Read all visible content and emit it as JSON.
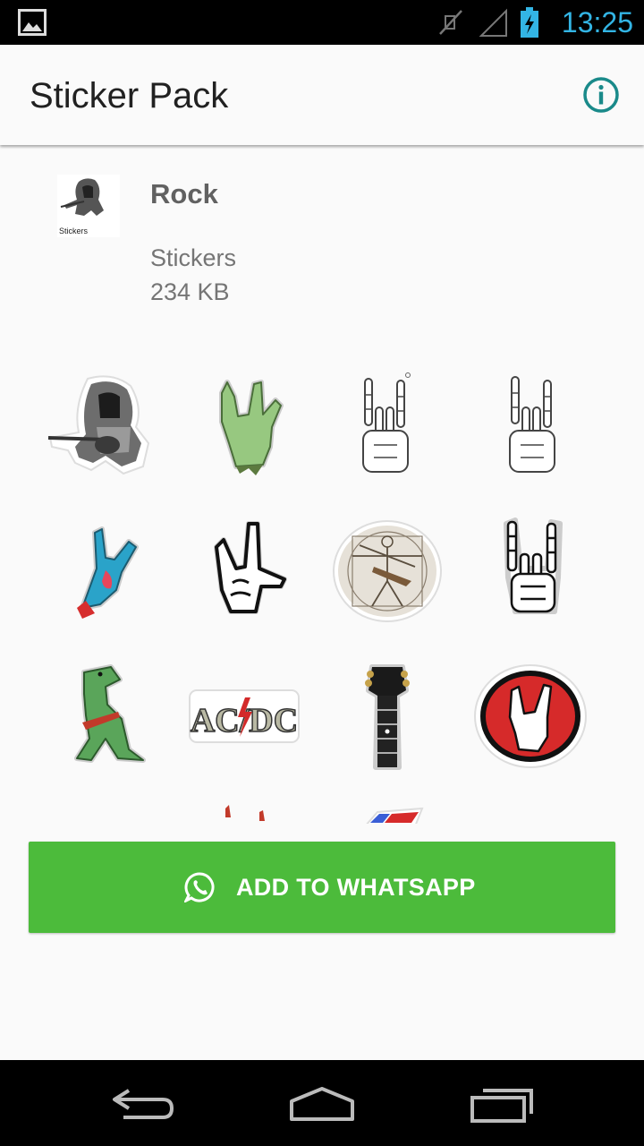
{
  "status_bar": {
    "time": "13:25",
    "time_color": "#33b5e5",
    "icons": [
      "image-icon",
      "mute-icon",
      "signal-icon",
      "battery-charging-icon"
    ]
  },
  "app_bar": {
    "title": "Sticker Pack",
    "info_icon": "info-icon",
    "accent": "#1a8a8a"
  },
  "pack": {
    "name": "Rock",
    "thumbnail_caption": "Stickers",
    "publisher": "Stickers",
    "size": "234 KB"
  },
  "stickers": [
    {
      "name": "rocker-guitarist"
    },
    {
      "name": "zombie-rock-hand"
    },
    {
      "name": "skeleton-rock-hand"
    },
    {
      "name": "skeleton-rock-hand"
    },
    {
      "name": "blue-rock-hand"
    },
    {
      "name": "cartoon-rock-hand"
    },
    {
      "name": "vitruvian-guitarist"
    },
    {
      "name": "skeleton-rock-hand"
    },
    {
      "name": "t-rex-guitar"
    },
    {
      "name": "ac-dc-logo"
    },
    {
      "name": "guitar-headstock"
    },
    {
      "name": "red-rock-hand-badge"
    },
    {
      "name": "partial-sticker"
    },
    {
      "name": "partial-sticker"
    }
  ],
  "acdc_text": "AC/DC",
  "add_button": {
    "label": "ADD TO WHATSAPP",
    "icon": "whatsapp-icon",
    "color": "#4cbb3b"
  },
  "nav_bar": {
    "back": "back-icon",
    "home": "home-icon",
    "recents": "recents-icon"
  }
}
